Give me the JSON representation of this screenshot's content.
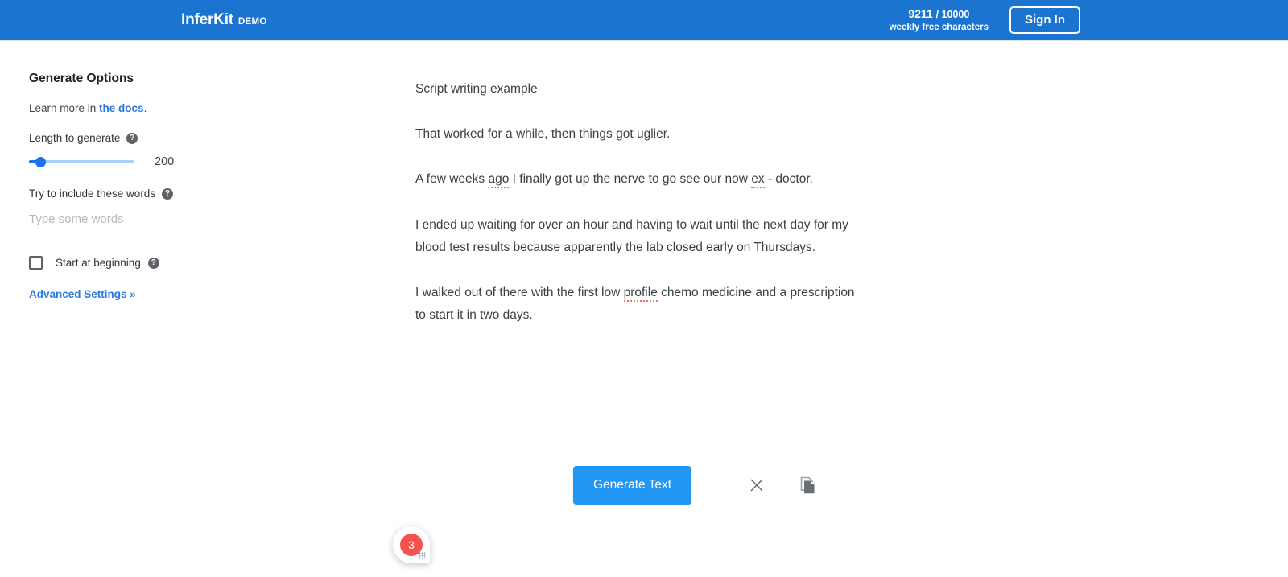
{
  "header": {
    "brand_name": "InferKit",
    "brand_tag": "DEMO",
    "quota_used": "9211",
    "quota_total": "/ 10000",
    "quota_caption": "weekly free characters",
    "sign_in_label": "Sign In",
    "background_color": "#1b75d0"
  },
  "sidebar": {
    "title": "Generate Options",
    "docs_prefix": "Learn more in ",
    "docs_link_label": "the docs",
    "docs_suffix": ".",
    "length_label": "Length to generate",
    "length_value": "200",
    "length_slider_percent": 10,
    "words_label": "Try to include these words",
    "words_value": "",
    "words_placeholder": "Type some words",
    "start_at_beginning_label": "Start at beginning",
    "start_at_beginning_checked": false,
    "advanced_label": "Advanced Settings »",
    "help_glyph": "?",
    "link_color": "#2a7ade"
  },
  "editor": {
    "paragraphs": [
      "Script writing example",
      "That worked for a while, then things got uglier.",
      "A few weeks ago I finally got up the nerve to go see our now ex - doctor.",
      "I ended up waiting for over an hour and having to wait until the next day for my blood test results because apparently the lab closed early on Thursdays.",
      "I walked out of there with the first low profile chemo medicine and a prescription to start it in two days."
    ],
    "misspelled_words": [
      "ago",
      "ex",
      "profile"
    ]
  },
  "actions": {
    "generate_label": "Generate Text",
    "clear_icon": "close-icon",
    "copy_icon": "copy-icon",
    "generate_color": "#2196f3"
  },
  "widget": {
    "badge_count": "3",
    "badge_color": "#f4524d"
  }
}
